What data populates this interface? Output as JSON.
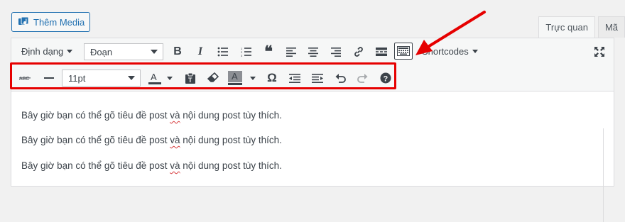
{
  "media_button": {
    "label": "Thêm Media",
    "icon": "media-icon"
  },
  "tabs": [
    {
      "label": "Trực quan",
      "active": true
    },
    {
      "label": "Mã",
      "active": false
    }
  ],
  "toolbar1": {
    "format_dropdown": "Định dạng",
    "paragraph_select": "Đoạn",
    "shortcodes": "Shortcodes",
    "buttons": [
      "bold-icon",
      "italic-icon",
      "bullet-list-icon",
      "numbered-list-icon",
      "blockquote-icon",
      "align-left-icon",
      "align-center-icon",
      "align-right-icon",
      "link-icon",
      "read-more-icon",
      "toolbar-toggle-icon"
    ],
    "fullscreen_icon": "fullscreen-icon"
  },
  "toolbar2": {
    "font_size": "11pt",
    "buttons": [
      "strikethrough-icon",
      "horizontal-line-icon",
      "text-color-icon",
      "paste-text-icon",
      "clear-formatting-icon",
      "background-color-icon",
      "special-character-icon",
      "outdent-icon",
      "indent-icon",
      "undo-icon",
      "redo-icon",
      "help-icon"
    ]
  },
  "content": {
    "lines": [
      {
        "before": "Bây giờ bạn có thể gõ tiêu đề post ",
        "misspelled": "và",
        "after": " nội dung post tùy thích."
      },
      {
        "before": "Bây giờ bạn có thể gõ tiêu đề post ",
        "misspelled": "và",
        "after": " nội dung post tùy thích."
      },
      {
        "before": "Bây giờ bạn có thể gõ tiêu đề post ",
        "misspelled": "và",
        "after": " nội dung post tùy thích."
      }
    ]
  },
  "colors": {
    "accent": "#2271b1",
    "highlight": "#e60000",
    "toolbar_bg": "#f6f7f7"
  }
}
